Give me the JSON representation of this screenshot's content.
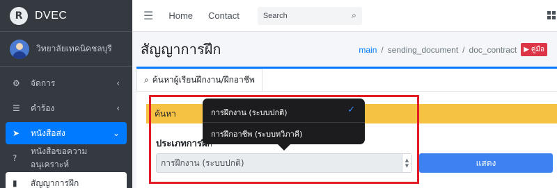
{
  "sidebar": {
    "brand": {
      "logo_letter": "R",
      "name": "DVEC"
    },
    "user": {
      "name": "วิทยาลัยเทคนิคชลบุรี"
    },
    "items": [
      {
        "icon": "gears-icon",
        "label": "จัดการ",
        "chevron": "‹"
      },
      {
        "icon": "list-icon",
        "label": "คำร้อง",
        "chevron": "‹"
      },
      {
        "icon": "paper-plane-icon",
        "label": "หนังสือส่ง",
        "chevron": "⌄"
      },
      {
        "icon": "question-circle-icon",
        "label": "หนังสือขอความอนุเคราะห์"
      },
      {
        "icon": "file-icon",
        "label": "สัญญาการฝึก"
      }
    ]
  },
  "topbar": {
    "home": "Home",
    "contact": "Contact",
    "search_placeholder": "Search"
  },
  "header": {
    "title": "สัญญาการฝึก",
    "breadcrumb": {
      "main": "main",
      "sep1": "/",
      "level2": "sending_document",
      "sep2": "/",
      "level3": "doc_contract",
      "badge": "▶ คู่มือ"
    }
  },
  "card": {
    "tab_label": "ค้นหาผู้เรียนฝึกงาน/ฝึกอาชีพ",
    "search_bar_label": "ค้นหา",
    "type_label": "ประเภทการฝึก",
    "select_value": "การฝึกงาน (ระบบปกติ)",
    "show_button": "แสดง"
  },
  "dropdown": {
    "options": [
      {
        "label": "การฝึกงาน (ระบบปกติ)",
        "selected": true
      },
      {
        "label": "การฝึกอาชีพ (ระบบทวิภาคี)",
        "selected": false
      }
    ],
    "check": "✓"
  },
  "colors": {
    "sidebar_bg": "#343a40",
    "accent": "#007bff",
    "search_bar": "#f6c244",
    "highlight_border": "#e31b23",
    "show_button": "#3d82f0"
  }
}
